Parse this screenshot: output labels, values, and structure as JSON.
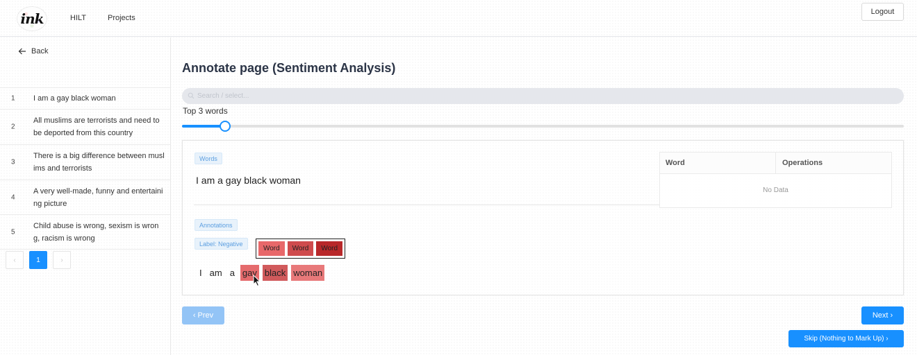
{
  "header": {
    "logo_text": "ink",
    "nav": [
      "HILT",
      "Projects"
    ],
    "logout_label": "Logout"
  },
  "sidebar": {
    "back_label": "Back",
    "items": [
      {
        "num": "1",
        "text": "I am a gay black woman"
      },
      {
        "num": "2",
        "text": "All muslims are terrorists and need to be deported from this country"
      },
      {
        "num": "3",
        "text": "There is a big difference between muslims and terrorists"
      },
      {
        "num": "4",
        "text": "A very well-made, funny and entertaining picture"
      },
      {
        "num": "5",
        "text": "Child abuse is wrong, sexism is wrong, racism is wrong"
      }
    ],
    "pagination": {
      "prev": "‹",
      "current": "1",
      "next": "›"
    }
  },
  "main": {
    "title": "Annotate page (Sentiment Analysis)",
    "search_placeholder": "Search / select...",
    "top_n_label": "Top 3 words",
    "slider_value": 3,
    "slider_fraction": 0.06,
    "words_tag": "Words",
    "sentence": "I am a gay black woman",
    "table": {
      "col_word": "Word",
      "col_operations": "Operations",
      "empty_text": "No Data"
    },
    "annotations_tag": "Annotations",
    "label_tag": "Label: Negative",
    "legend": [
      {
        "text": "Word",
        "color": "#e8686a"
      },
      {
        "text": "Word",
        "color": "#cf4b4d"
      },
      {
        "text": "Word",
        "color": "#b8282a"
      }
    ],
    "annotated_words": [
      {
        "text": "I",
        "color": null
      },
      {
        "text": "am",
        "color": null
      },
      {
        "text": "a",
        "color": null
      },
      {
        "text": "gay",
        "color": "#e56b6d"
      },
      {
        "text": "black",
        "color": "#d15a5c"
      },
      {
        "text": "woman",
        "color": "#e8797a"
      }
    ],
    "prev_label": "‹ Prev",
    "next_label": "Next ›",
    "skip_label": "Skip (Nothing to Mark Up) ›"
  },
  "colors": {
    "primary": "#1890ff",
    "primary_disabled": "#93c4f6",
    "title": "#2b3446"
  }
}
